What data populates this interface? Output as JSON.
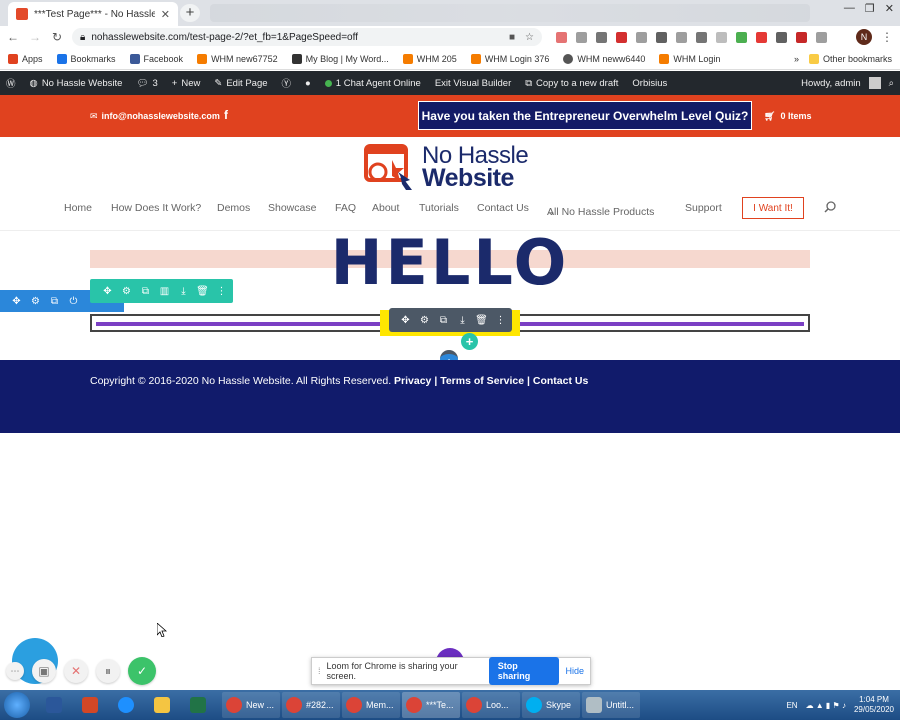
{
  "browser": {
    "tab_title": "***Test Page*** - No Hassle Web",
    "url": "nohasslewebsite.com/test-page-2/?et_fb=1&PageSpeed=off",
    "bookmarks": [
      "Apps",
      "Bookmarks",
      "Facebook",
      "WHM new67752",
      "My Blog | My Word...",
      "WHM 205",
      "WHM Login 376",
      "WHM neww6440",
      "WHM Login"
    ],
    "other_bookmarks": "Other bookmarks",
    "profile_initial": "N"
  },
  "wp_admin_bar": {
    "site": "No Hassle Website",
    "comments": "3",
    "new": "New",
    "edit_page": "Edit Page",
    "chat": "1 Chat Agent Online",
    "exit_builder": "Exit Visual Builder",
    "copy_draft": "Copy to a new draft",
    "orbisius": "Orbisius",
    "howdy": "Howdy, admin"
  },
  "topbar": {
    "email": "info@nohasslewebsite.com",
    "facebook": "f",
    "quiz_button": "Have you taken the Entrepreneur Overwhelm Level Quiz?",
    "cart": "0 Items"
  },
  "logo": {
    "line1": "No Hassle",
    "line2": "Website"
  },
  "nav": {
    "items": [
      "Home",
      "How Does It Work?",
      "Demos",
      "Showcase",
      "FAQ",
      "About",
      "Tutorials",
      "Contact Us",
      "All No Hassle Products",
      "Support"
    ],
    "cta": "I Want It!"
  },
  "content": {
    "heading": "HELLO"
  },
  "footer": {
    "copyright": "Copyright © 2016-2020 No Hassle Website. All Rights Reserved.",
    "privacy": "Privacy",
    "terms": "Terms of Service",
    "contact": "Contact Us",
    "sep": "|"
  },
  "loom": {
    "share_text": "Loom for Chrome is sharing your screen.",
    "stop": "Stop sharing",
    "hide": "Hide"
  },
  "taskbar": {
    "windows": [
      "New ...",
      "#282...",
      "Mem...",
      "***Te...",
      "Loo...",
      "Skype",
      "Untitl..."
    ],
    "lang": "EN",
    "time": "1:04 PM",
    "date": "29/05/2020"
  },
  "colors": {
    "accent_orange": "#e0421f",
    "navy": "#111b6b",
    "builder_blue": "#2b87da",
    "builder_green": "#29c4a9"
  }
}
